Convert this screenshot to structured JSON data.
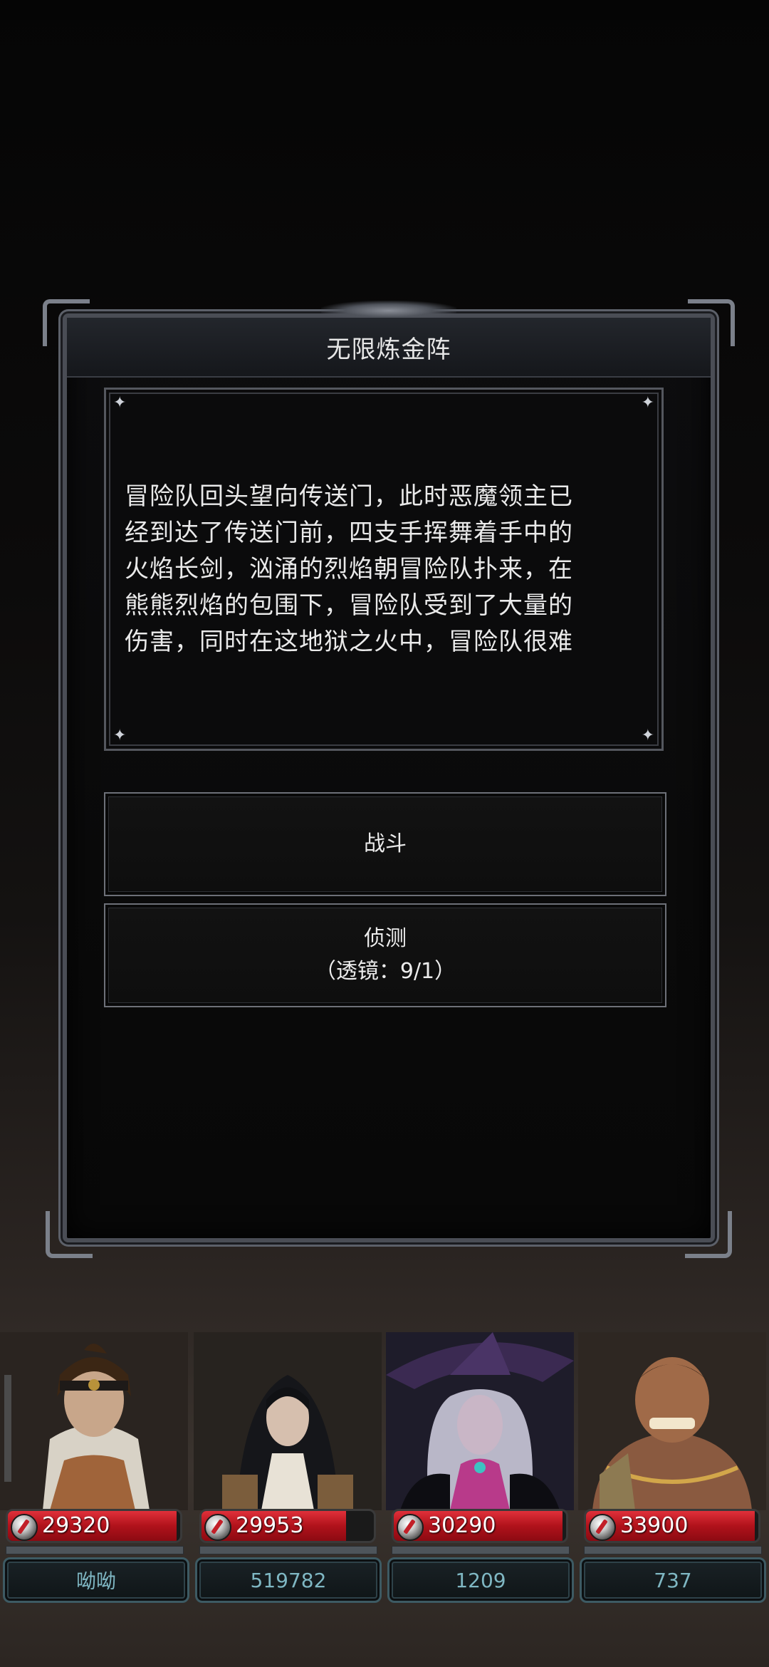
{
  "dialog": {
    "title": "无限炼金阵",
    "story_lines": [
      "冒险队回头望向传送门，此时恶魔领主已",
      "经到达了传送门前，四支手挥舞着手中的",
      "火焰长剑，汹涌的烈焰朝冒险队扑来，在",
      "熊熊烈焰的包围下，冒险队受到了大量的",
      "伤害，同时在这地狱之火中，冒险队很难"
    ],
    "options": [
      {
        "label": "战斗"
      },
      {
        "label": "侦测",
        "sub": "（透镜：9/1）"
      }
    ]
  },
  "heroes": [
    {
      "hp": "29320",
      "hp_fraction": 0.98,
      "name": "呦呦",
      "portrait": "warrior-woman-portrait"
    },
    {
      "hp": "29953",
      "hp_fraction": 0.84,
      "name": "519782",
      "portrait": "nun-portrait"
    },
    {
      "hp": "30290",
      "hp_fraction": 0.98,
      "name": "1209",
      "portrait": "witch-portrait"
    },
    {
      "hp": "33900",
      "hp_fraction": 0.98,
      "name": "737",
      "portrait": "brute-portrait"
    }
  ],
  "colors": {
    "hp_red": "#c0141f",
    "frame_silver": "#7b808a",
    "name_teal": "#7fb7c3"
  }
}
